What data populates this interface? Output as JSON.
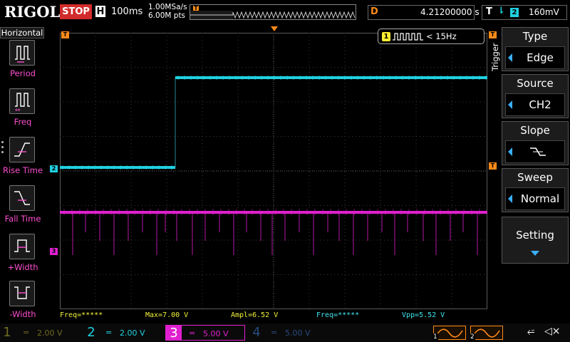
{
  "topbar": {
    "brand": "RIGOL",
    "run_state": "STOP",
    "timebase_badge": "H",
    "timebase": "100ms",
    "sample_rate": "1.00MSa/s",
    "memory_depth": "6.00M pts",
    "delay_badge": "D",
    "delay": "4.21200000 s",
    "trigger_badge": "T",
    "trigger_source": "2",
    "trigger_level": "160mV"
  },
  "left_menu": {
    "title": "Horizontal",
    "items": [
      {
        "label": "Period"
      },
      {
        "label": "Freq"
      },
      {
        "label": "Rise Time"
      },
      {
        "label": "Fall Time"
      },
      {
        "label": "+Width"
      },
      {
        "label": "-Width"
      }
    ]
  },
  "trigger_info": {
    "badge": "1",
    "text": "< 15Hz"
  },
  "markers": {
    "ch2": "2",
    "ch3": "3",
    "trigger": "T"
  },
  "measurements": [
    {
      "text": "Freq=*****",
      "color": "#f2f23a"
    },
    {
      "text": "Max=7.00 V",
      "color": "#f2f23a"
    },
    {
      "text": "Ampl=6.52 V",
      "color": "#f2f23a"
    },
    {
      "text": "Freq=*****",
      "color": "#3fe6f0"
    },
    {
      "text": "Vpp=5.52 V",
      "color": "#3fe6f0"
    }
  ],
  "channels": [
    {
      "num": "1",
      "coupling": "=",
      "scale": "2.00 V",
      "color": "#6f6a20"
    },
    {
      "num": "2",
      "coupling": "=",
      "scale": "2.00 V",
      "color": "#1fd0e0"
    },
    {
      "num": "3",
      "coupling": "=",
      "scale": "5.00 V",
      "color": "#e020d0"
    },
    {
      "num": "4",
      "coupling": "=",
      "scale": "5.00 V",
      "color": "#2a4a80"
    }
  ],
  "trigger_mini": [
    {
      "num": "1"
    },
    {
      "num": "2"
    }
  ],
  "right_menu": {
    "title": "Trigger",
    "type_label": "Type",
    "type_value": "Edge",
    "source_label": "Source",
    "source_value": "CH2",
    "slope_label": "Slope",
    "sweep_label": "Sweep",
    "sweep_value": "Normal",
    "setting_label": "Setting"
  },
  "colors": {
    "ch2": "#1fd0e0",
    "ch3": "#e020d0",
    "trigger": "#ff8a1a",
    "menu_accent": "#3ab0ff"
  }
}
